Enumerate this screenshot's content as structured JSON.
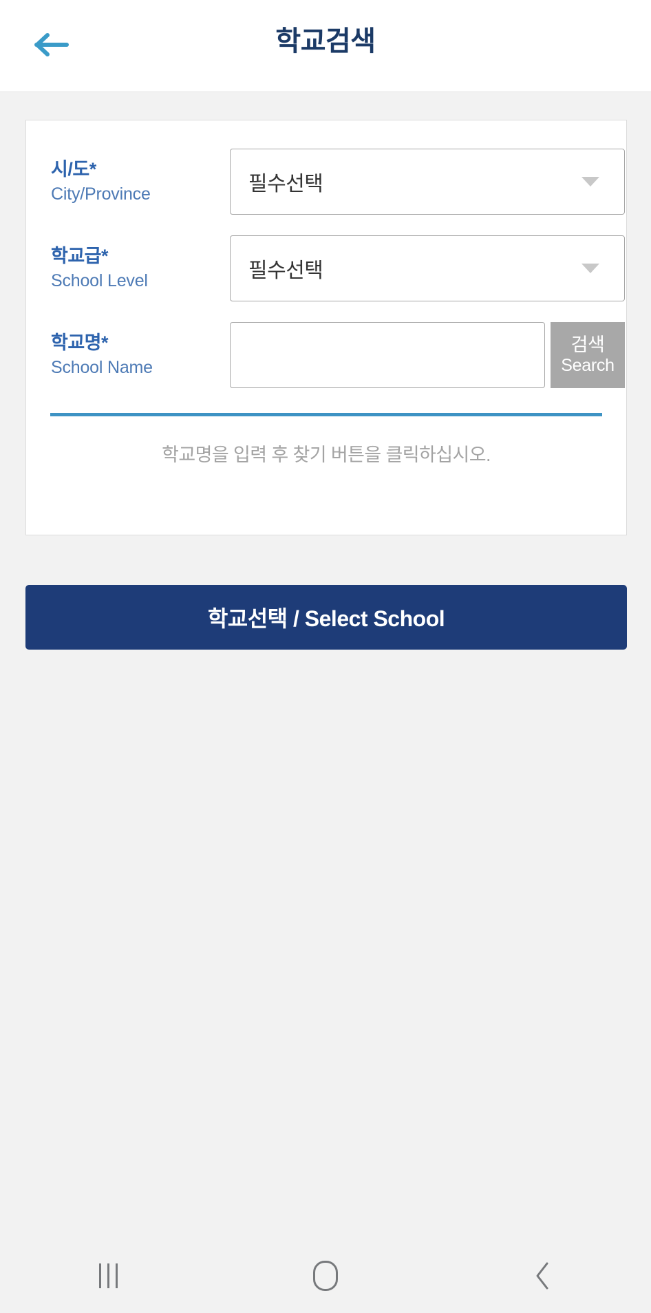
{
  "header": {
    "back_icon": "arrow-left-icon",
    "title": "학교검색"
  },
  "form": {
    "fields": [
      {
        "label_ko": "시/도",
        "required_mark": "*",
        "label_en": "City/Province",
        "type": "select",
        "value": "필수선택",
        "caret_icon": "chevron-down-icon"
      },
      {
        "label_ko": "학교급",
        "required_mark": "*",
        "label_en": "School Level",
        "type": "select",
        "value": "필수선택",
        "caret_icon": "chevron-down-icon"
      },
      {
        "label_ko": "학교명",
        "required_mark": "*",
        "label_en": "School Name",
        "type": "text",
        "value": "",
        "placeholder": ""
      }
    ],
    "search_button": {
      "label_ko": "검색",
      "label_en": "Search"
    },
    "hint": "학교명을 입력 후 찾기 버튼을 클릭하십시오."
  },
  "primary_button": {
    "label": "학교선택 / Select School"
  },
  "navbar": {
    "recents_icon": "recents-icon",
    "home_icon": "home-icon",
    "back_icon": "chevron-left-icon"
  },
  "colors": {
    "page_background": "#f2f2f2",
    "header_background": "#ffffff",
    "title_text": "#1b3a66",
    "back_arrow": "#3a9bc8",
    "label_ko_text": "#2d63ad",
    "label_en_text": "#4d7ab5",
    "select_border": "#a6a6a6",
    "select_value_text": "#333333",
    "search_button_background": "#a8a8a8",
    "divider": "#3e93c4",
    "hint_text": "#a3a3a3",
    "primary_button_background": "#1e3c78",
    "primary_button_text": "#ffffff",
    "navbar_icon": "#77797c"
  }
}
